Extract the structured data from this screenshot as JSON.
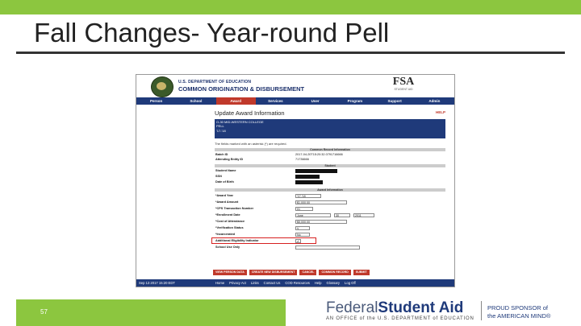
{
  "slide": {
    "title": "Fall Changes- Year-round Pell",
    "number": "57"
  },
  "app": {
    "dept": "U.S. DEPARTMENT OF EDUCATION",
    "system": "COMMON ORIGINATION & DISBURSEMENT",
    "logo_text": "FSA",
    "logo_sub": "STUDENT AID",
    "nav": [
      "Person",
      "School",
      "Award",
      "Services",
      "User",
      "Program",
      "Support",
      "Admin"
    ],
    "active_nav": "Award",
    "page_heading": "Update Award Information",
    "help": "HELP",
    "bluebox": [
      "O-30 MID-WESTERN COLLEGE",
      "PELL",
      "'17-'18"
    ],
    "note": "The fields marked with an asterisk (*) are required.",
    "sections": {
      "common": "Common Record Information",
      "student": "Student",
      "award": "Award Information"
    },
    "common_rows": [
      {
        "label": "Batch ID",
        "value": "2017-04-20T15:20:32.0791716666"
      },
      {
        "label": "Attending Entity ID",
        "value": "71736666"
      }
    ],
    "student_rows": [
      {
        "label": "Student Name"
      },
      {
        "label": "SSN"
      },
      {
        "label": "Date of Birth"
      }
    ],
    "award_rows": [
      {
        "label": "*Award Year",
        "value": "'17-'18"
      },
      {
        "label": "*Award Amount",
        "value": "$1,000.00"
      },
      {
        "label": "*CPS Transaction Number",
        "value": "01"
      },
      {
        "label": "*Enrollment Date",
        "value": "June",
        "value2": "30",
        "value3": "2011"
      },
      {
        "label": "*Cost of Attendance",
        "value": "$5,000.00"
      },
      {
        "label": "*Verification Status",
        "value": "V"
      },
      {
        "label": "*Incarcerated",
        "value": "No"
      },
      {
        "label": "Additional Eligibility Indicator",
        "value": "✔"
      },
      {
        "label": "School Use Only",
        "value": ""
      }
    ],
    "buttons": [
      "VIEW PERSON DATA",
      "CREATE NEW DISBURSEMENT",
      "CANCEL",
      "COMMON RECORD",
      "SUBMIT"
    ],
    "footer_date": "Sep 13 2017 15:20 EDT",
    "footer_links": [
      "Home",
      "Privacy Act",
      "Links",
      "Contact Us",
      "COD Resources",
      "Help",
      "Glossary",
      "Log Off"
    ]
  },
  "brand": {
    "light": "Federal",
    "bold": "Student Aid",
    "tagline": "AN OFFICE of the U.S. DEPARTMENT of EDUCATION",
    "sponsor_line1": "PROUD SPONSOR of",
    "sponsor_line2": "the AMERICAN MIND®"
  },
  "colors": {
    "accent_green": "#8cc63f",
    "nav_blue": "#1f3a7a",
    "highlight_red": "#d62020"
  }
}
